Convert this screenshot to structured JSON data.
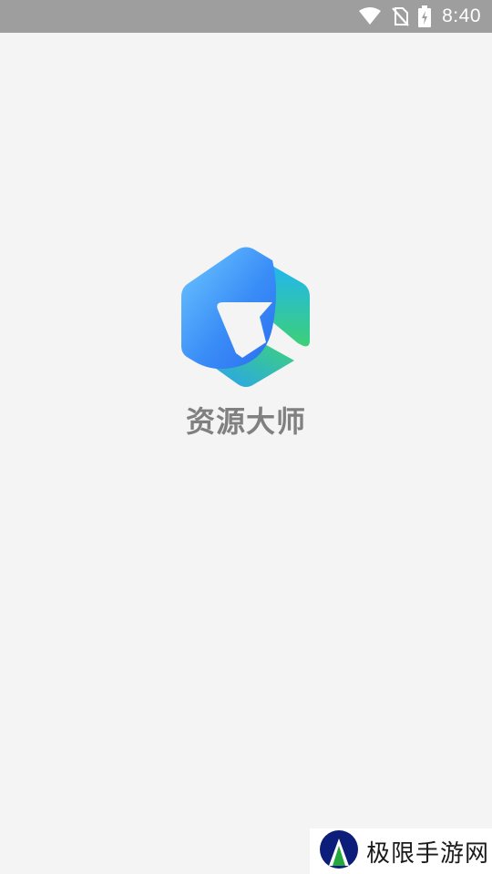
{
  "status_bar": {
    "time": "8:40",
    "icons": [
      "wifi-icon",
      "no-sim-icon",
      "battery-charging-icon"
    ]
  },
  "splash": {
    "app_name": "资源大师",
    "logo": "hexagon-arrow-logo",
    "colors": {
      "background": "#f4f4f4",
      "logo_blue": "#2f7ff5",
      "logo_light_blue": "#5cc0ff",
      "logo_green": "#35d07a"
    }
  },
  "watermark": {
    "text": "极限手游网",
    "logo": "watermark-logo"
  }
}
